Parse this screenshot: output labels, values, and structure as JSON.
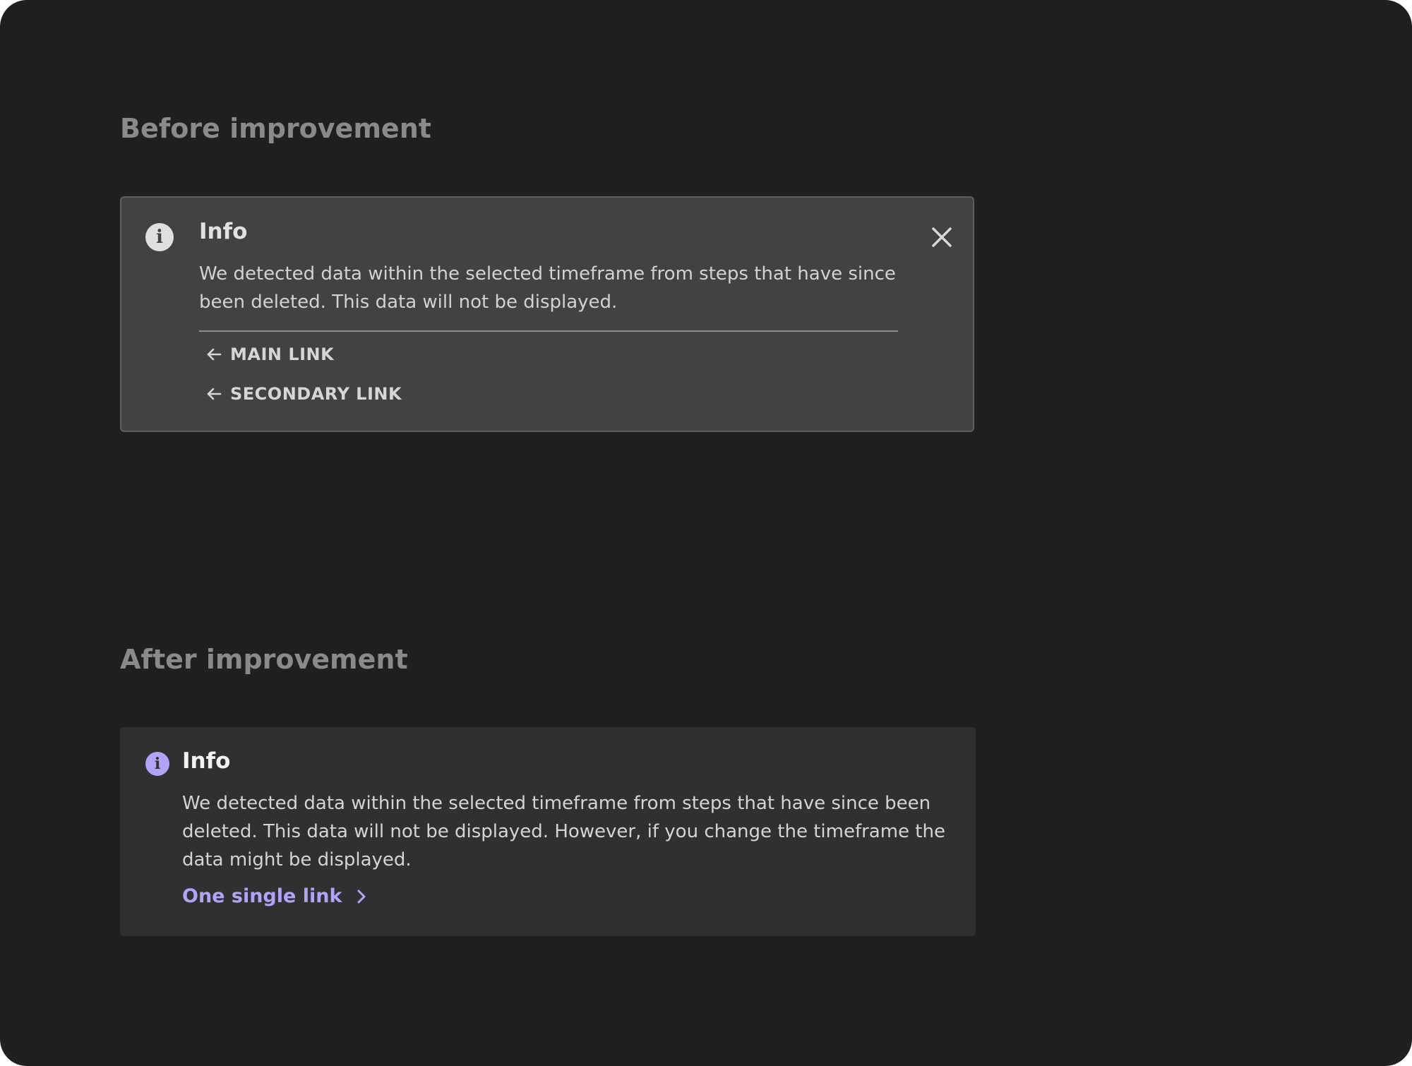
{
  "colors": {
    "frame_background": "#1f1f1f",
    "section_title": "#8a8a8a",
    "before_card_background": "#424242",
    "after_card_background": "#303030",
    "accent_purple": "#b4a2f8"
  },
  "before": {
    "section_title": "Before improvement",
    "card": {
      "icon": "info-icon",
      "title": "Info",
      "body": "We detected data within the selected timeframe from steps that have since been deleted. This data will not be displayed.",
      "close_icon": "close-icon",
      "links": [
        {
          "icon": "arrow-left-icon",
          "label": "MAIN LINK"
        },
        {
          "icon": "arrow-left-icon",
          "label": "SECONDARY LINK"
        }
      ]
    }
  },
  "after": {
    "section_title": "After improvement",
    "card": {
      "icon": "info-icon",
      "title": "Info",
      "body": "We detected data within the selected timeframe from steps that have since been deleted. This data will not be displayed. However, if you change the timeframe the data might be displayed.",
      "link": {
        "label": "One single link",
        "icon": "chevron-right-icon"
      }
    }
  }
}
